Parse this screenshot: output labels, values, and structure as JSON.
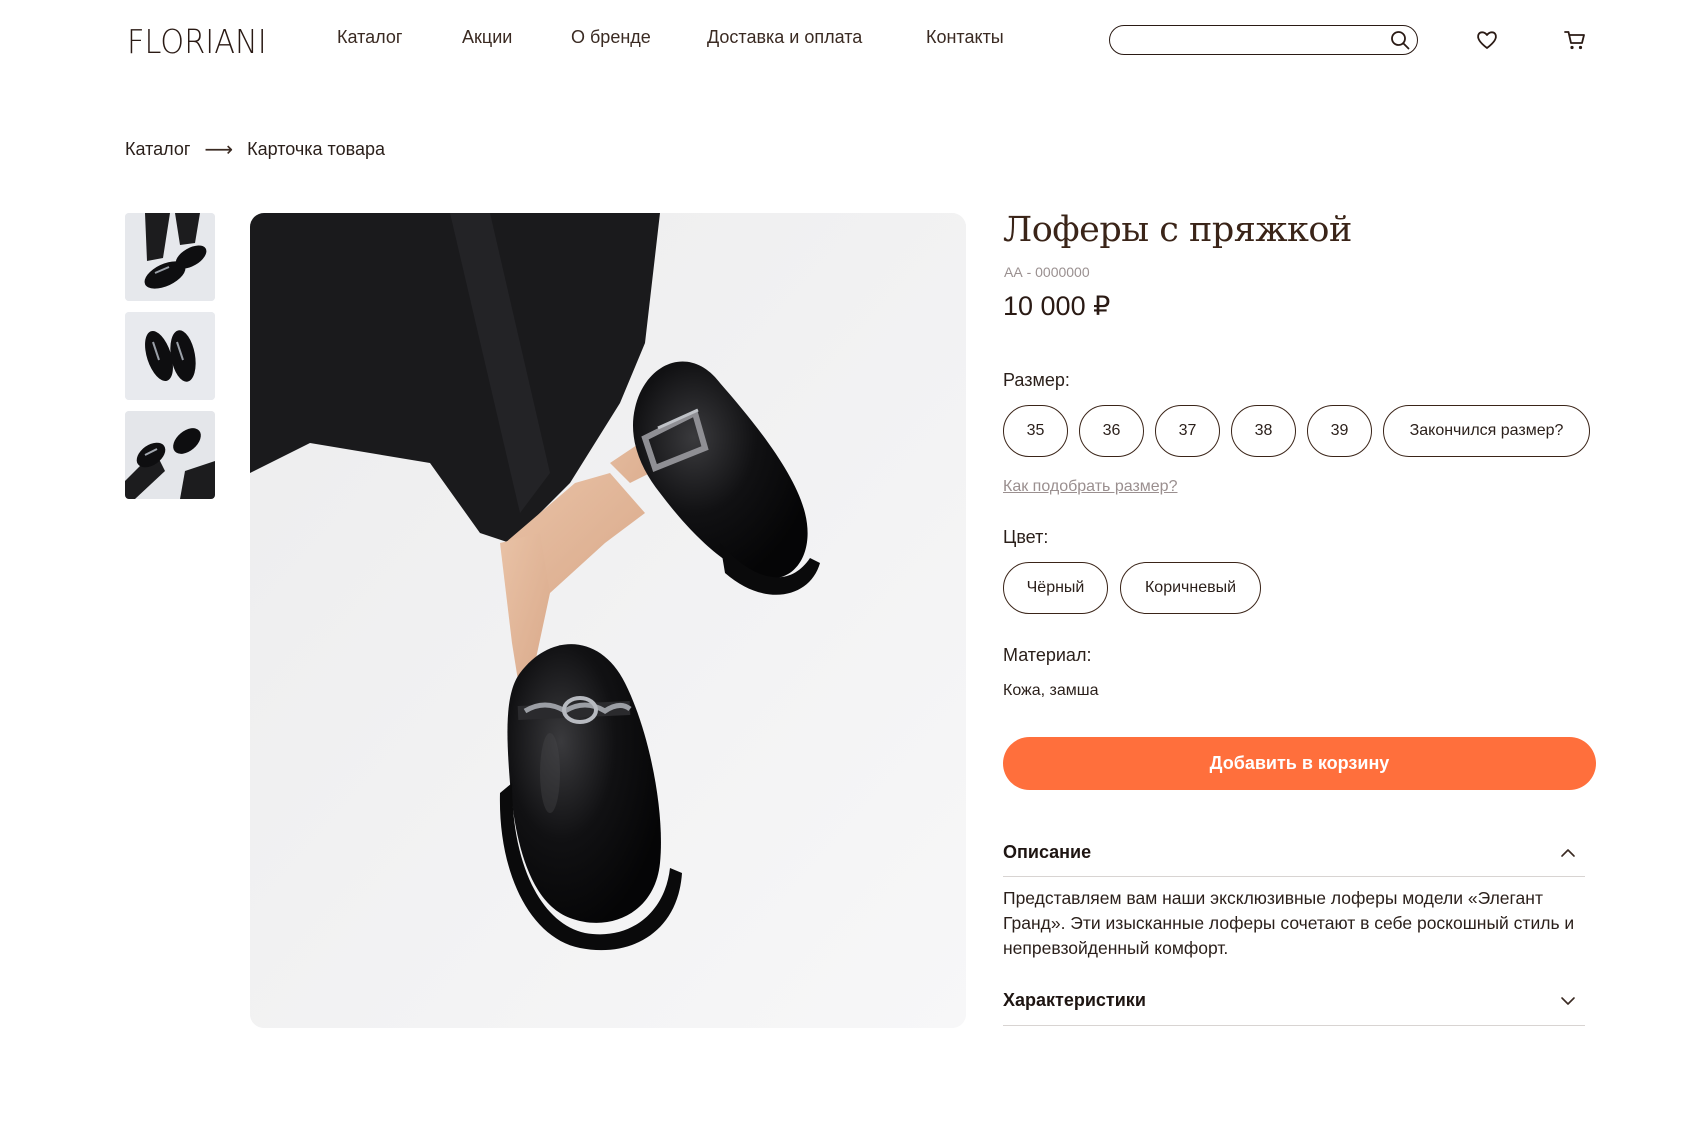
{
  "header": {
    "logo": "FLORIANI",
    "nav": [
      "Каталог",
      "Акции",
      "О бренде",
      "Доставка и оплата",
      "Контакты"
    ],
    "search_placeholder": "",
    "icons": [
      "search-icon",
      "heart-icon",
      "cart-icon"
    ]
  },
  "breadcrumb": {
    "items": [
      "Каталог",
      "Карточка товара"
    ],
    "separator": "⟶"
  },
  "product": {
    "title": "Лоферы с пряжкой",
    "sku": "АА - 0000000",
    "price": "10 000 ₽",
    "size_label": "Размер:",
    "sizes": [
      "35",
      "36",
      "37",
      "38",
      "39"
    ],
    "size_request": "Закончился размер?",
    "size_help": "Как подобрать размер?",
    "color_label": "Цвет:",
    "colors": [
      "Чёрный",
      "Коричневый"
    ],
    "material_label": "Материал:",
    "material_value": "Кожа, замша",
    "add_to_cart": "Добавить в корзину",
    "accordion": [
      {
        "title": "Описание",
        "expanded": true,
        "body": "Представляем вам наши эксклюзивные лоферы модели «Элегант Гранд». Эти изысканные лоферы сочетают в себе роскошный стиль и непревзойденный комфорт."
      },
      {
        "title": "Характеристики",
        "expanded": false,
        "body": ""
      }
    ]
  },
  "colors": {
    "accent": "#ff6f3c",
    "text": "#2a1f1a",
    "border": "#3a2418",
    "muted": "#9a9090"
  }
}
